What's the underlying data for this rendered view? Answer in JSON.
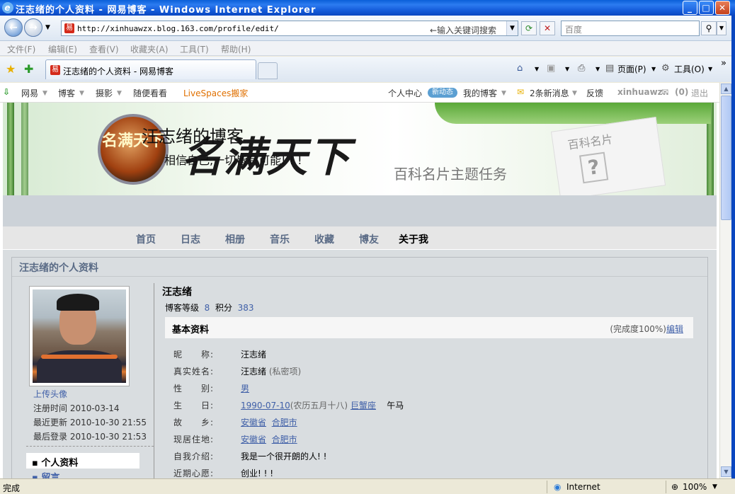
{
  "window": {
    "title": "汪志绪的个人资料 - 网易博客 - Windows Internet Explorer",
    "min": "_",
    "max": "□",
    "close": "✕"
  },
  "address": {
    "url": "http://xinhuawzx.blog.163.com/profile/edit/",
    "hint": "←输入关键词搜索",
    "search_placeholder": "百度"
  },
  "menu": [
    "文件(F)",
    "编辑(E)",
    "查看(V)",
    "收藏夹(A)",
    "工具(T)",
    "帮助(H)"
  ],
  "tabs": {
    "active": "汪志绪的个人资料 - 网易博客",
    "page_label": "页面(P)",
    "tools_label": "工具(O)"
  },
  "topnav": {
    "items": [
      "网易",
      "博客",
      "摄影",
      "随便看看"
    ],
    "live": "LiveSpaces搬家",
    "center": "个人中心",
    "new_badge": "新动态",
    "myblog": "我的博客",
    "messages": "2条新消息",
    "feedback": "反馈",
    "user": "xinhuawz..",
    "mail": "(0)",
    "logout": "退出"
  },
  "banner": {
    "title": "汪志绪的博客",
    "motto": "相信自己,一切皆有可能! ! !",
    "badge_text": "名满天下",
    "calligraphy": "名满天下",
    "theme": "百科名片主题任务",
    "card_title": "百科名片"
  },
  "blognav": [
    "首页",
    "日志",
    "相册",
    "音乐",
    "收藏",
    "博友",
    "关于我"
  ],
  "profile": {
    "panel_title": "汪志绪的个人资料",
    "upload": "上传头像",
    "registered": "注册时间 2010-03-14",
    "updated": "最近更新 2010-10-30 21:55",
    "last_login": "最后登录 2010-10-30 21:53",
    "menu_active": "个人资料",
    "menu_next": "留言",
    "name": "汪志绪",
    "level_label": "博客等级",
    "level": "8",
    "points_label": "积分",
    "points": "383",
    "section": "基本资料",
    "completion": "(完成度100%)",
    "edit": "编辑",
    "fields": {
      "nick_l": "昵　　称:",
      "nick": "汪志绪",
      "real_l": "真实姓名:",
      "real": "汪志绪",
      "real_note": "(私密项)",
      "sex_l": "性　　别:",
      "sex": "男",
      "bday_l": "生　　日:",
      "bday": "1990-07-10",
      "lunar": "(农历五月十八)",
      "zodiac": "巨蟹座",
      "animal": "午马",
      "home_l": "故　　乡:",
      "home_p": "安徽省",
      "home_c": "合肥市",
      "live_l": "现居住地:",
      "live_p": "安徽省",
      "live_c": "合肥市",
      "intro_l": "自我介绍:",
      "intro": "我是一个很开朗的人! !",
      "wish_l": "近期心愿:",
      "wish": "创业! ! !"
    }
  },
  "status": {
    "left": "完成",
    "zone": "Internet",
    "zoom": "100%"
  }
}
